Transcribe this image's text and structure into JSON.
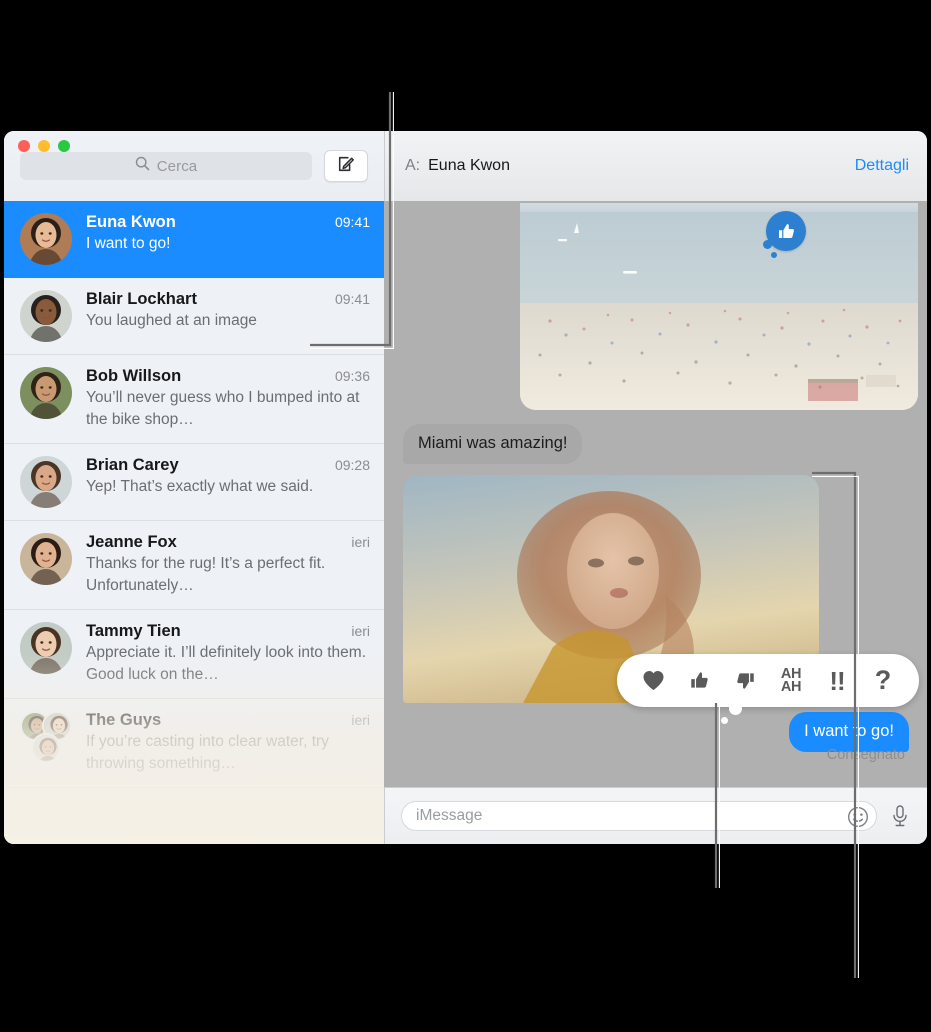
{
  "window": {
    "traffic_lights": [
      {
        "name": "close",
        "color": "#ff5f57"
      },
      {
        "name": "minimize",
        "color": "#ffbd2e"
      },
      {
        "name": "zoom",
        "color": "#28c840"
      }
    ]
  },
  "sidebar": {
    "search": {
      "placeholder": "Cerca",
      "value": "",
      "icon": "search-icon"
    },
    "compose_button": {
      "icon": "compose-icon",
      "label": ""
    },
    "conversations": [
      {
        "name": "Euna Kwon",
        "time": "09:41",
        "snippet": "I want to go!",
        "selected": true,
        "avatar": "woman-dark-hair-avatar"
      },
      {
        "name": "Blair Lockhart",
        "time": "09:41",
        "snippet": "You laughed at an image",
        "selected": false,
        "avatar": "woman-curly-hair-avatar"
      },
      {
        "name": "Bob Willson",
        "time": "09:36",
        "snippet": "You’ll never guess who I bumped into at the bike shop…",
        "selected": false,
        "avatar": "man-beard-avatar"
      },
      {
        "name": "Brian Carey",
        "time": "09:28",
        "snippet": "Yep! That’s exactly what we said.",
        "selected": false,
        "avatar": "man-long-hair-avatar"
      },
      {
        "name": "Jeanne Fox",
        "time": "ieri",
        "snippet": "Thanks for the rug! It’s a perfect fit. Unfortunately…",
        "selected": false,
        "avatar": "woman-brunette-avatar"
      },
      {
        "name": "Tammy Tien",
        "time": "ieri",
        "snippet": "Appreciate it. I’ll definitely look into them. Good luck on the…",
        "selected": false,
        "avatar": "woman-glasses-avatar"
      },
      {
        "name": "The Guys",
        "time": "ieri",
        "snippet": "If you’re casting into clear water, try throwing something…",
        "selected": false,
        "avatar": "group-avatar"
      }
    ]
  },
  "conversation": {
    "to_label": "A:",
    "to_name": "Euna Kwon",
    "details_link": "Dettagli",
    "messages": [
      {
        "type": "image",
        "name": "beach-photo",
        "from": "them",
        "description": "crowded beach with sea and boats"
      },
      {
        "type": "text",
        "name": "miami-bubble",
        "from": "them",
        "text": "Miami was amazing!"
      },
      {
        "type": "image",
        "name": "portrait-photo",
        "from": "them",
        "description": "woman with curly hair at sunset",
        "tapback": "thumbs-up"
      },
      {
        "type": "text",
        "name": "i-want-to-go-bubble",
        "from": "me",
        "text": "I want to go!",
        "status": "Consegnato"
      }
    ]
  },
  "tapback_picker": {
    "options": [
      {
        "name": "heart",
        "label": "♥"
      },
      {
        "name": "thumbs-up",
        "label": ""
      },
      {
        "name": "thumbs-down",
        "label": ""
      },
      {
        "name": "haha",
        "label": "AH AH"
      },
      {
        "name": "exclamation",
        "label": "!!"
      },
      {
        "name": "question",
        "label": "?"
      }
    ]
  },
  "composer": {
    "placeholder": "iMessage",
    "value": "",
    "emoji_button": "smiley-icon",
    "mic_button": "microphone-icon"
  },
  "colors": {
    "accent_blue": "#1a8cff",
    "selected_row": "#1a8cff",
    "tapback_blue": "#2d7fd0",
    "message_gray": "#a8a8a8",
    "background": "#b0b0b0"
  }
}
